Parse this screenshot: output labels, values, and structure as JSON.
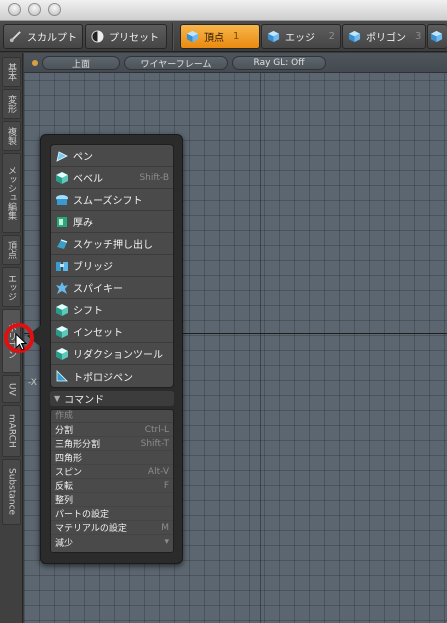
{
  "toolbar": {
    "sculpt": "スカルプト",
    "preset": "プリセット",
    "modes": [
      {
        "label": "頂点",
        "num": "1",
        "active": true
      },
      {
        "label": "エッジ",
        "num": "2",
        "active": false
      },
      {
        "label": "ポリゴン",
        "num": "3",
        "active": false
      },
      {
        "label": "マ",
        "num": "",
        "active": false
      }
    ]
  },
  "side_tabs": [
    "基本",
    "変形",
    "複製",
    "メッシュ編集",
    "頂点",
    "エッジ",
    "ポリゴン",
    "UV",
    "mARCH",
    "Substance"
  ],
  "viewport": {
    "view_label": "上面",
    "shading_label": "ワイヤーフレーム",
    "raygl_label": "Ray GL: Off",
    "axis_label": "-X"
  },
  "palette": {
    "tools": [
      {
        "label": "ペン",
        "shortcut": "",
        "icon": "pen-icon"
      },
      {
        "label": "ベベル",
        "shortcut": "Shift-B",
        "icon": "bevel-icon"
      },
      {
        "label": "スムーズシフト",
        "shortcut": "",
        "icon": "smooth-shift-icon"
      },
      {
        "label": "厚み",
        "shortcut": "",
        "icon": "thicken-icon"
      },
      {
        "label": "スケッチ押し出し",
        "shortcut": "",
        "icon": "sketch-extrude-icon"
      },
      {
        "label": "ブリッジ",
        "shortcut": "",
        "icon": "bridge-icon"
      },
      {
        "label": "スパイキー",
        "shortcut": "",
        "icon": "spikey-icon"
      },
      {
        "label": "シフト",
        "shortcut": "",
        "icon": "shift-icon"
      },
      {
        "label": "インセット",
        "shortcut": "",
        "icon": "inset-icon"
      },
      {
        "label": "リダクションツール",
        "shortcut": "",
        "icon": "reduction-icon"
      },
      {
        "label": "トポロジペン",
        "shortcut": "",
        "icon": "topology-pen-icon"
      }
    ],
    "commands_header": "コマンド",
    "commands_sub": "作成",
    "commands": [
      {
        "label": "分割",
        "shortcut": "Ctrl-L"
      },
      {
        "label": "三角形分割",
        "shortcut": "Shift-T"
      },
      {
        "label": "四角形",
        "shortcut": ""
      },
      {
        "label": "スピン",
        "shortcut": "Alt-V"
      },
      {
        "label": "反転",
        "shortcut": "F"
      },
      {
        "label": "整列",
        "shortcut": ""
      },
      {
        "label": "パートの設定",
        "shortcut": ""
      },
      {
        "label": "マテリアルの設定",
        "shortcut": "M"
      },
      {
        "label": "減少",
        "shortcut": "▾"
      }
    ]
  },
  "colors": {
    "accent": "#f0a020",
    "viewport_bg": "#5b6670",
    "cursor_ring": "#e01010"
  }
}
